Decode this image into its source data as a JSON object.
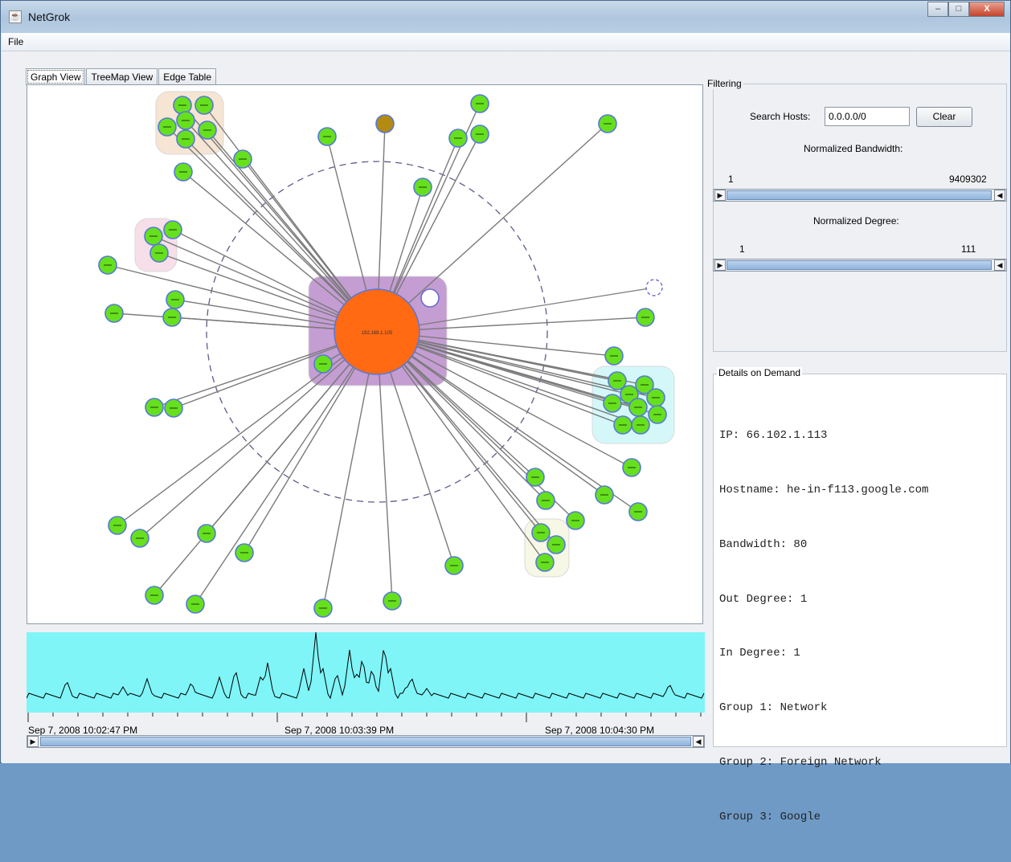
{
  "window": {
    "title": "NetGrok",
    "controls": [
      "–",
      "□",
      "X"
    ]
  },
  "menu": {
    "file": "File"
  },
  "tabs": [
    {
      "label": "Graph View",
      "active": true
    },
    {
      "label": "TreeMap View",
      "active": false
    },
    {
      "label": "Edge Table",
      "active": false
    }
  ],
  "graph": {
    "center_label": "192.168.1.105",
    "colors": {
      "center": "#ff6a13",
      "node": "#66e01c",
      "node_border": "#5577dd",
      "selected_node": "#b38a12",
      "edge": "#7a7a7a",
      "ring": "#5c5c8a"
    }
  },
  "timeline": {
    "labels": [
      "Sep 7, 2008 10:02:47 PM",
      "Sep 7, 2008 10:03:39 PM",
      "Sep 7, 2008 10:04:30 PM"
    ],
    "colors": {
      "fill": "#7ff5f8",
      "line": "#000000"
    }
  },
  "filtering": {
    "title": "Filtering",
    "search_label": "Search Hosts:",
    "search_value": "0.0.0.0/0",
    "clear_label": "Clear",
    "bandwidth_label": "Normalized Bandwidth:",
    "bandwidth_min": "1",
    "bandwidth_max": "9409302",
    "degree_label": "Normalized Degree:",
    "degree_min": "1",
    "degree_max": "111"
  },
  "details": {
    "title": "Details on Demand",
    "lines": [
      "IP: 66.102.1.113",
      "Hostname: he-in-f113.google.com",
      "Bandwidth: 80",
      "Out Degree: 1",
      "In Degree: 1",
      "Group 1: Network",
      "Group 2: Foreign Network",
      "Group 3: Google"
    ]
  }
}
